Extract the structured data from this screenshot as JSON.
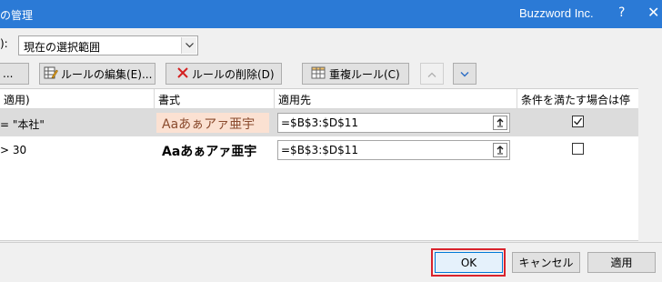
{
  "window": {
    "title_partial": "の管理",
    "brand": "Buzzword Inc.",
    "help_label": "?",
    "close_label": "✕"
  },
  "scope": {
    "label_partial": "):",
    "selected": "現在の選択範囲"
  },
  "toolbar": {
    "new_partial": "...",
    "edit_label": "ルールの編集(E)...",
    "delete_label": "ルールの削除(D)",
    "duplicate_label": "重複ルール(C)",
    "move_up_icon": "triangle-up-icon",
    "move_down_icon": "chevron-down-icon"
  },
  "table": {
    "columns": [
      "適用)",
      "書式",
      "適用先",
      "条件を満たす場合は停止"
    ],
    "rows": [
      {
        "rule": "= \"本社\"",
        "preview": "Aaあぁアァ亜宇",
        "applies_to": "=$B$3:$D$11",
        "stop_if_true": true,
        "selected": true
      },
      {
        "rule": "> 30",
        "preview": "Aaあぁアァ亜宇",
        "applies_to": "=$B$3:$D$11",
        "stop_if_true": false,
        "selected": false
      }
    ]
  },
  "footer": {
    "ok": "OK",
    "cancel": "キャンセル",
    "apply": "適用"
  },
  "colors": {
    "titlebar": "#2b7ad6",
    "ok_focus": "#d9232d",
    "selected_row": "#dcdcdc"
  }
}
